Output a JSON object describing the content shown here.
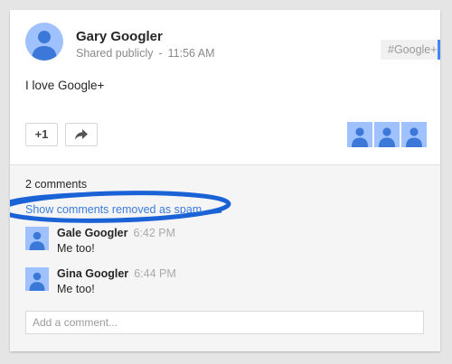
{
  "post": {
    "author": "Gary Googler",
    "visibility": "Shared publicly",
    "separator": "-",
    "time": "11:56 AM",
    "hashtag": "#Google+",
    "text": "I love Google+"
  },
  "actions": {
    "plusone_label": "+1",
    "share_icon": "share-arrow-icon"
  },
  "plusers": {
    "avatar_icon": "person-icon"
  },
  "comments": {
    "count_label": "2 comments",
    "spam_link": "Show comments removed as spam.",
    "items": [
      {
        "name": "Gale Googler",
        "time": "6:42 PM",
        "text": "Me too!"
      },
      {
        "name": "Gina Googler",
        "time": "6:44 PM",
        "text": "Me too!"
      }
    ],
    "input_placeholder": "Add a comment..."
  },
  "colors": {
    "accent_blue": "#4285f4",
    "link_blue": "#3b7bdc",
    "avatar_bg": "#9fc2ff",
    "avatar_person": "#3c78d8",
    "highlight_oval": "#1a63d6"
  }
}
